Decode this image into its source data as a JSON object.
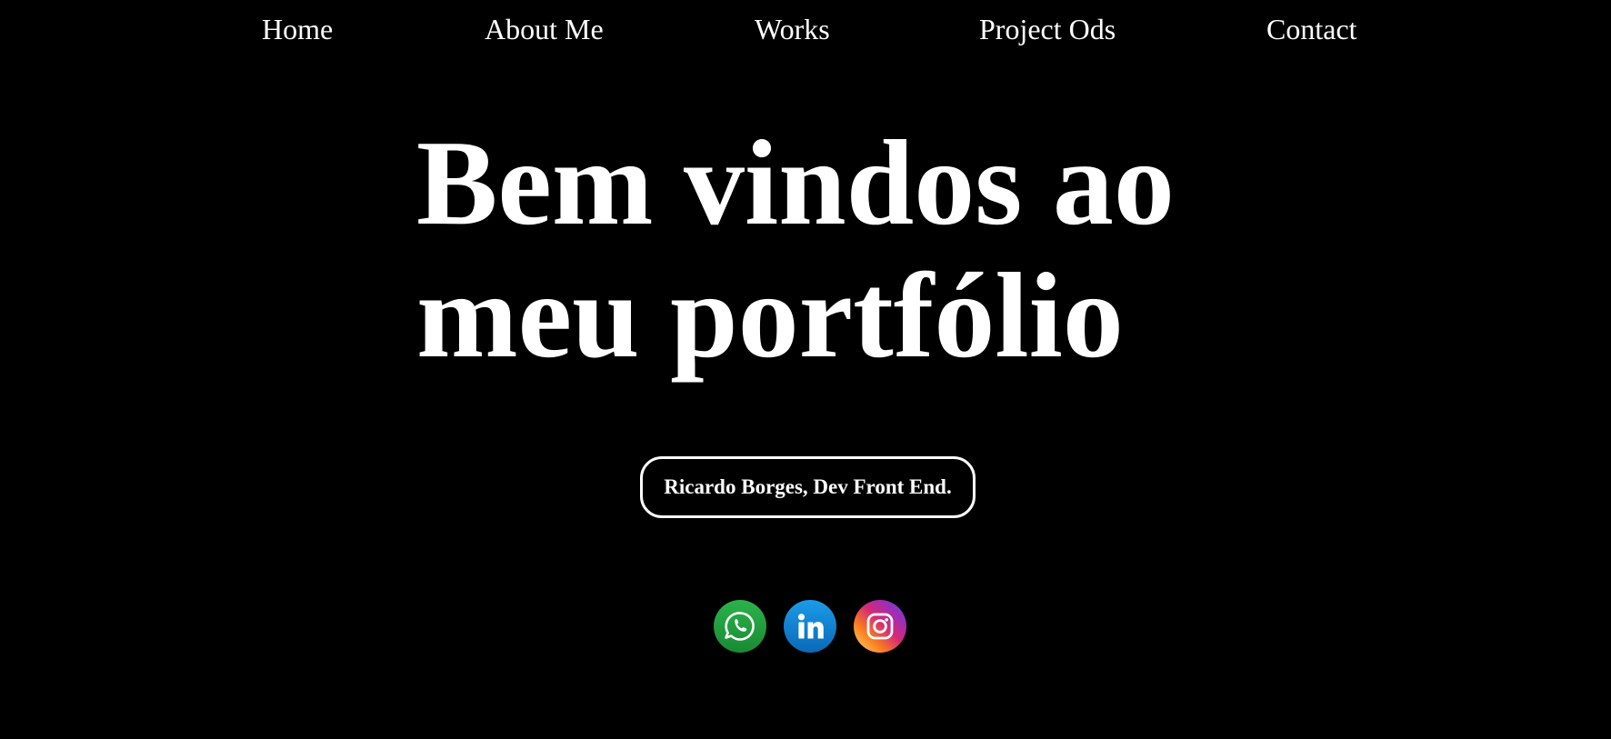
{
  "nav": {
    "items": [
      {
        "label": "Home"
      },
      {
        "label": "About Me"
      },
      {
        "label": "Works"
      },
      {
        "label": "Project Ods"
      },
      {
        "label": "Contact"
      }
    ]
  },
  "hero": {
    "line1": "Bem vindos ao",
    "line2": "meu portfólio"
  },
  "tagline": "Ricardo Borges, Dev Front End.",
  "social": [
    {
      "icon": "whatsapp-icon",
      "color": "#25a244"
    },
    {
      "icon": "linkedin-icon",
      "color": "#0a80d0"
    },
    {
      "icon": "instagram-icon",
      "color": "#d62976"
    }
  ],
  "colors": {
    "background": "#000000",
    "text": "#ffffff"
  }
}
